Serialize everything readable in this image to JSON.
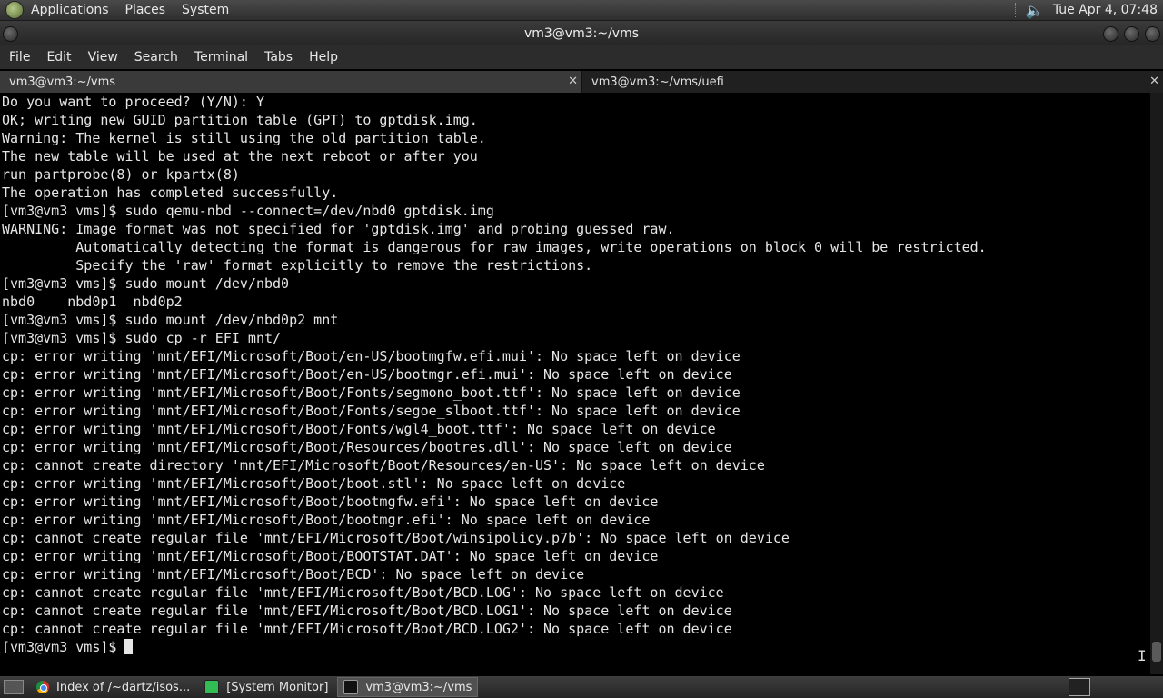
{
  "top_panel": {
    "menus": [
      "Applications",
      "Places",
      "System"
    ],
    "clock": "Tue Apr  4, 07:48"
  },
  "window": {
    "title": "vm3@vm3:~/vms"
  },
  "menubar": [
    "File",
    "Edit",
    "View",
    "Search",
    "Terminal",
    "Tabs",
    "Help"
  ],
  "tabs": [
    {
      "label": "vm3@vm3:~/vms",
      "active": true
    },
    {
      "label": "vm3@vm3:~/vms/uefi",
      "active": false
    }
  ],
  "terminal": {
    "lines": [
      "Do you want to proceed? (Y/N): Y",
      "OK; writing new GUID partition table (GPT) to gptdisk.img.",
      "Warning: The kernel is still using the old partition table.",
      "The new table will be used at the next reboot or after you",
      "run partprobe(8) or kpartx(8)",
      "The operation has completed successfully.",
      "[vm3@vm3 vms]$ sudo qemu-nbd --connect=/dev/nbd0 gptdisk.img",
      "WARNING: Image format was not specified for 'gptdisk.img' and probing guessed raw.",
      "         Automatically detecting the format is dangerous for raw images, write operations on block 0 will be restricted.",
      "         Specify the 'raw' format explicitly to remove the restrictions.",
      "[vm3@vm3 vms]$ sudo mount /dev/nbd0",
      "nbd0    nbd0p1  nbd0p2",
      "[vm3@vm3 vms]$ sudo mount /dev/nbd0p2 mnt",
      "[vm3@vm3 vms]$ sudo cp -r EFI mnt/",
      "cp: error writing 'mnt/EFI/Microsoft/Boot/en-US/bootmgfw.efi.mui': No space left on device",
      "cp: error writing 'mnt/EFI/Microsoft/Boot/en-US/bootmgr.efi.mui': No space left on device",
      "cp: error writing 'mnt/EFI/Microsoft/Boot/Fonts/segmono_boot.ttf': No space left on device",
      "cp: error writing 'mnt/EFI/Microsoft/Boot/Fonts/segoe_slboot.ttf': No space left on device",
      "cp: error writing 'mnt/EFI/Microsoft/Boot/Fonts/wgl4_boot.ttf': No space left on device",
      "cp: error writing 'mnt/EFI/Microsoft/Boot/Resources/bootres.dll': No space left on device",
      "cp: cannot create directory 'mnt/EFI/Microsoft/Boot/Resources/en-US': No space left on device",
      "cp: error writing 'mnt/EFI/Microsoft/Boot/boot.stl': No space left on device",
      "cp: error writing 'mnt/EFI/Microsoft/Boot/bootmgfw.efi': No space left on device",
      "cp: error writing 'mnt/EFI/Microsoft/Boot/bootmgr.efi': No space left on device",
      "cp: cannot create regular file 'mnt/EFI/Microsoft/Boot/winsipolicy.p7b': No space left on device",
      "cp: error writing 'mnt/EFI/Microsoft/Boot/BOOTSTAT.DAT': No space left on device",
      "cp: error writing 'mnt/EFI/Microsoft/Boot/BCD': No space left on device",
      "cp: cannot create regular file 'mnt/EFI/Microsoft/Boot/BCD.LOG': No space left on device",
      "cp: cannot create regular file 'mnt/EFI/Microsoft/Boot/BCD.LOG1': No space left on device",
      "cp: cannot create regular file 'mnt/EFI/Microsoft/Boot/BCD.LOG2': No space left on device"
    ],
    "prompt": "[vm3@vm3 vms]$ "
  },
  "taskbar": [
    {
      "label": "Index of /~dartz/isos...",
      "icon": "chrome-icon",
      "active": false
    },
    {
      "label": "[System Monitor]",
      "icon": "system-monitor-icon",
      "active": false
    },
    {
      "label": "vm3@vm3:~/vms",
      "icon": "terminal-icon",
      "active": true
    }
  ]
}
